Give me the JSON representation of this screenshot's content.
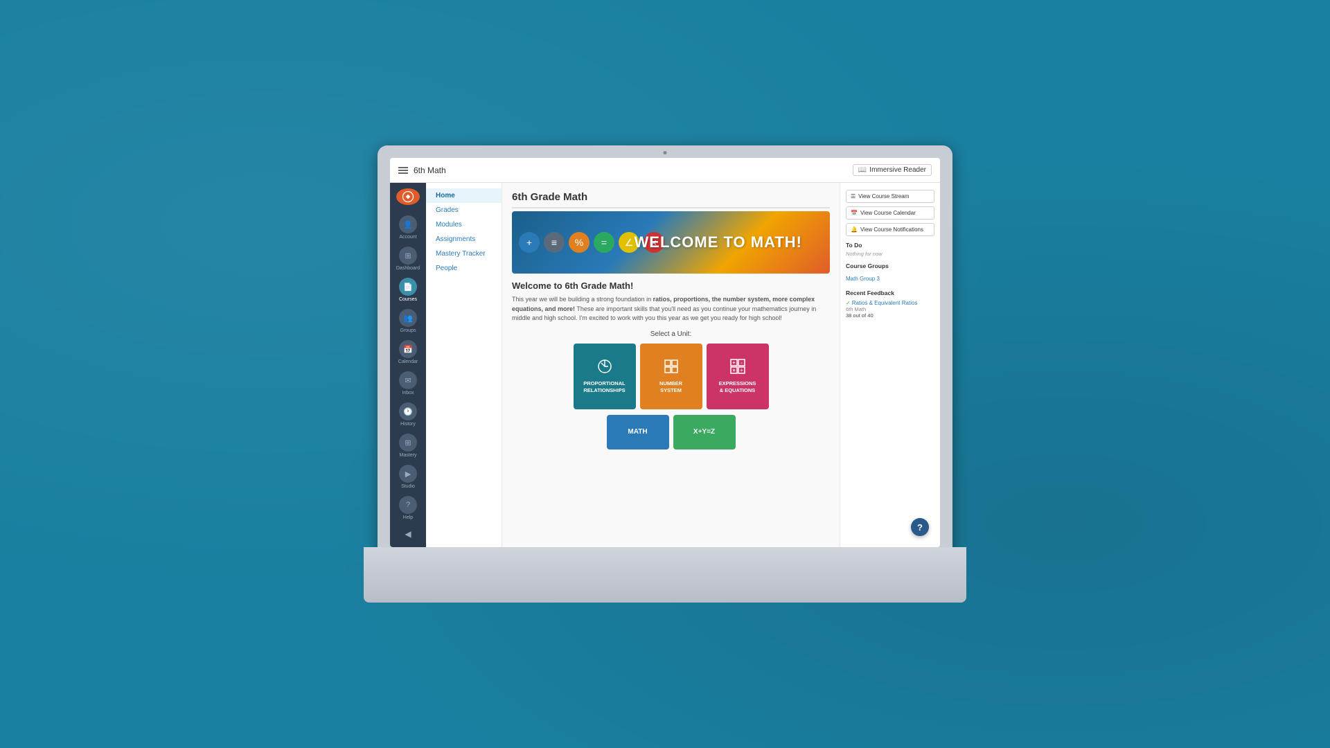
{
  "background": {
    "color": "#1a7fa0"
  },
  "topbar": {
    "menu_icon": "☰",
    "title": "6th Math",
    "immersive_reader_label": "Immersive Reader"
  },
  "sidebar": {
    "items": [
      {
        "id": "account",
        "label": "Account",
        "icon": "👤"
      },
      {
        "id": "dashboard",
        "label": "Dashboard",
        "icon": "⊞"
      },
      {
        "id": "courses",
        "label": "Courses",
        "icon": "📄",
        "active": true
      },
      {
        "id": "groups",
        "label": "Groups",
        "icon": "👥"
      },
      {
        "id": "calendar",
        "label": "Calendar",
        "icon": "📅"
      },
      {
        "id": "inbox",
        "label": "Inbox",
        "icon": "✉"
      },
      {
        "id": "history",
        "label": "History",
        "icon": "🕐"
      },
      {
        "id": "mastery",
        "label": "Mastery",
        "icon": "⊞"
      },
      {
        "id": "studio",
        "label": "Studio",
        "icon": "▶"
      },
      {
        "id": "help",
        "label": "Help",
        "icon": "?"
      }
    ],
    "collapse_icon": "◀"
  },
  "left_nav": {
    "items": [
      {
        "label": "Home",
        "active": true
      },
      {
        "label": "Grades",
        "active": false
      },
      {
        "label": "Modules",
        "active": false
      },
      {
        "label": "Assignments",
        "active": false
      },
      {
        "label": "Mastery Tracker",
        "active": false
      },
      {
        "label": "People",
        "active": false
      }
    ]
  },
  "main": {
    "course_title": "6th Grade Math",
    "banner_text": "WELCOME TO MATH!",
    "welcome_heading": "Welcome to 6th Grade Math!",
    "welcome_body_part1": "This year we will be building a strong foundation in ",
    "welcome_body_bold": "ratios, proportions, the number system, more complex equations, and more!",
    "welcome_body_part2": " These are important skills that you'll need as you continue your mathematics journey in middle and high school. I'm excited to work with you this year as we get you ready for high school!",
    "select_unit_label": "Select a Unit:",
    "units": [
      {
        "id": "proportional",
        "label": "PROPORTIONAL\nRELATIONSHIPS",
        "color": "teal",
        "icon": "◎"
      },
      {
        "id": "number-system",
        "label": "NUMBER\nSYSTEM",
        "color": "orange",
        "icon": "⊞"
      },
      {
        "id": "expressions",
        "label": "EXPRESSIONS\n& EQUATIONS",
        "color": "pink",
        "icon": "⊞"
      }
    ],
    "units_row2": [
      {
        "id": "math",
        "label": "MATH",
        "color": "blue"
      },
      {
        "id": "algebra",
        "label": "X+Y=Z",
        "color": "green"
      }
    ]
  },
  "right_panel": {
    "view_course_stream_label": "View Course Stream",
    "view_course_calendar_label": "View Course Calendar",
    "view_course_notifications_label": "View Course Notifications",
    "todo_section": "To Do",
    "nothing_for_now": "Nothing for now",
    "course_groups_label": "Course Groups",
    "math_group_link": "Math Group 3",
    "recent_feedback_label": "Recent Feedback",
    "feedback_item": {
      "title": "Ratios & Equivalent Ratios",
      "course": "6th Math",
      "score": "38 out of 40"
    }
  },
  "help_fab": "?"
}
